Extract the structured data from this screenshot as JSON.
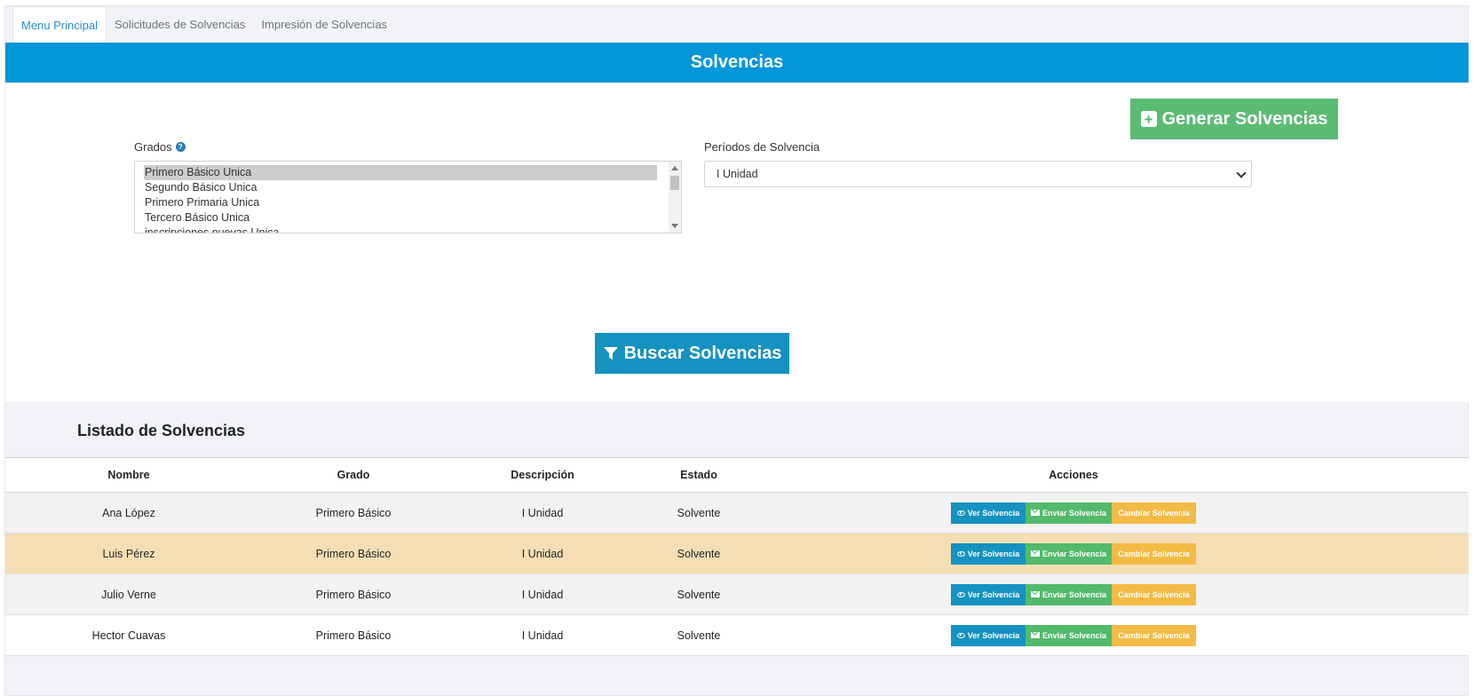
{
  "tabs": [
    {
      "label": "Menu Principal",
      "active": true
    },
    {
      "label": "Solicitudes de Solvencias",
      "active": false
    },
    {
      "label": "Impresión de Solvencias",
      "active": false
    }
  ],
  "panel": {
    "title": "Solvencias",
    "generate_button": "Generar Solvencias",
    "grados_label": "Grados",
    "grados_options": [
      "Primero Básico Unica",
      "Segundo Básico Unica",
      "Primero Primaria Unica",
      "Tercero Básico Unica",
      "inscripciones nuevas Unica"
    ],
    "grados_selected": "Primero Básico Unica",
    "periodos_label": "Períodos de Solvencia",
    "periodos_selected": "I Unidad",
    "search_button": "Buscar Solvencias"
  },
  "list": {
    "title": "Listado de Solvencias",
    "columns": [
      "Nombre",
      "Grado",
      "Descripción",
      "Estado",
      "Acciones"
    ],
    "rows": [
      {
        "nombre": "Ana López",
        "grado": "Primero Básico",
        "descripcion": "I Unidad",
        "estado": "Solvente"
      },
      {
        "nombre": "Luis Pérez",
        "grado": "Primero Básico",
        "descripcion": "I Unidad",
        "estado": "Solvente"
      },
      {
        "nombre": "Julio Verne",
        "grado": "Primero Básico",
        "descripcion": "I Unidad",
        "estado": "Solvente"
      },
      {
        "nombre": "Hector Cuavas",
        "grado": "Primero Básico",
        "descripcion": "I Unidad",
        "estado": "Solvente"
      }
    ],
    "actions": {
      "view": "Ver Solvencia",
      "send": "Enviar Solvencia",
      "change": "Cambiar Solvencia"
    }
  },
  "colors": {
    "header_blue": "#0396d8",
    "success_green": "#5cbb73",
    "info_blue": "#1592c0",
    "warning_yellow": "#f3bb45",
    "highlight_row": "#f5deb3"
  }
}
